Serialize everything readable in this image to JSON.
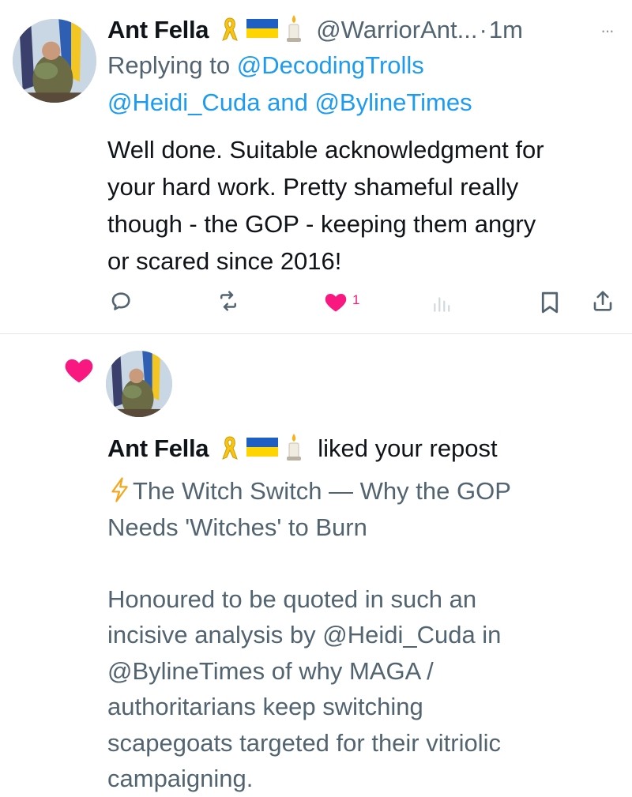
{
  "reply_tweet": {
    "author_name": "Ant Fella",
    "badges": [
      "yellow-ribbon-icon",
      "ukraine-flag-icon",
      "candle-icon"
    ],
    "handle": "@WarriorAnt...",
    "separator": "·",
    "time": "1m",
    "more": "···",
    "replying_prefix": "Replying to",
    "replying_mention_1": "@DecodingTrolls",
    "replying_mention_2": "@Heidi_Cuda",
    "replying_and": "and",
    "replying_mention_3": "@BylineTimes",
    "body_lines": [
      "Well done. Suitable acknowledgment for",
      "your hard work. Pretty shameful really",
      "though - the GOP - keeping them angry",
      "or scared since 2016!"
    ],
    "like_count": "1",
    "colors": {
      "like": "#f91880",
      "link": "#1d9bf0",
      "muted": "#536471"
    }
  },
  "notification": {
    "type_icon": "heart-icon",
    "author_name": "Ant Fella",
    "action_text": "liked your repost",
    "quoted_emoji": "lightning-bolt-icon",
    "quoted_lines": [
      "The Witch Switch — Why the GOP",
      "Needs 'Witches' to Burn",
      "",
      "Honoured to be quoted in such an",
      "incisive analysis by @Heidi_Cuda in",
      "@BylineTimes of why MAGA /",
      "authoritarians keep switching",
      "scapegoats targeted for their vitriolic",
      "campaigning."
    ]
  }
}
